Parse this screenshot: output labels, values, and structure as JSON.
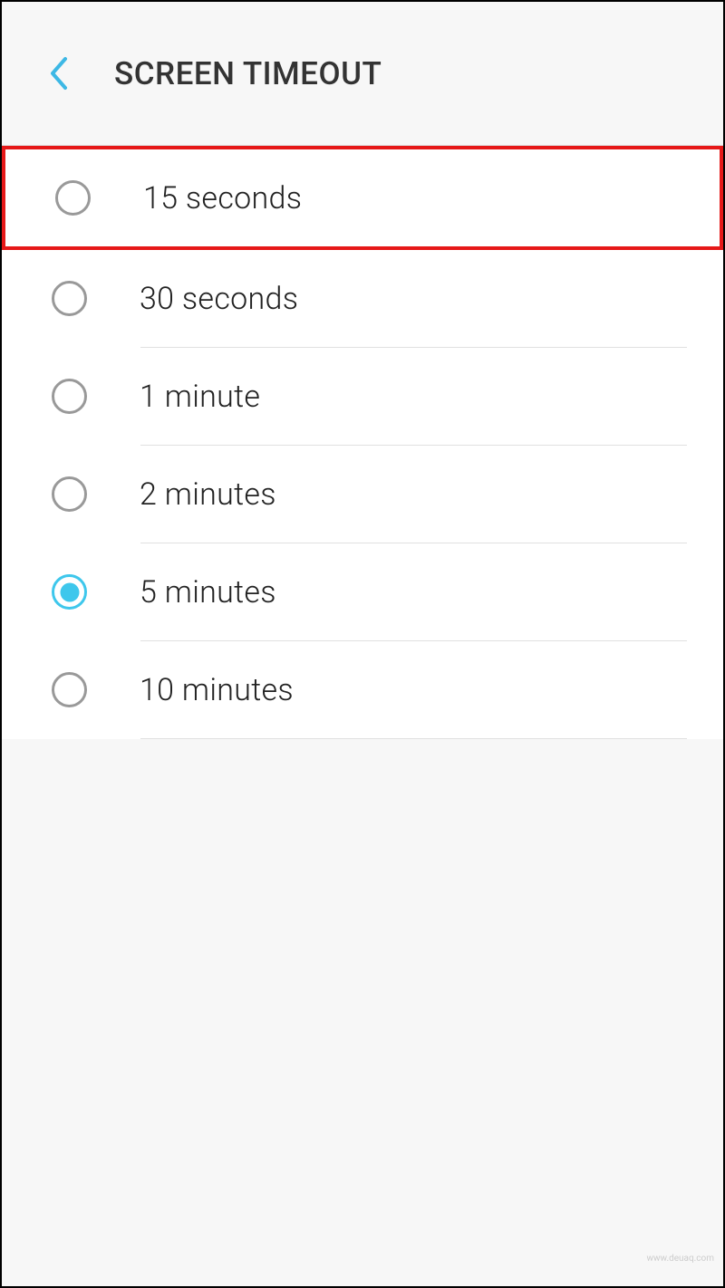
{
  "header": {
    "title": "SCREEN TIMEOUT"
  },
  "options": [
    {
      "label": "15 seconds",
      "selected": false,
      "highlighted": true
    },
    {
      "label": "30 seconds",
      "selected": false,
      "highlighted": false
    },
    {
      "label": "1 minute",
      "selected": false,
      "highlighted": false
    },
    {
      "label": "2 minutes",
      "selected": false,
      "highlighted": false
    },
    {
      "label": "5 minutes",
      "selected": true,
      "highlighted": false
    },
    {
      "label": "10 minutes",
      "selected": false,
      "highlighted": false
    }
  ],
  "watermark": "www.deuaq.com"
}
